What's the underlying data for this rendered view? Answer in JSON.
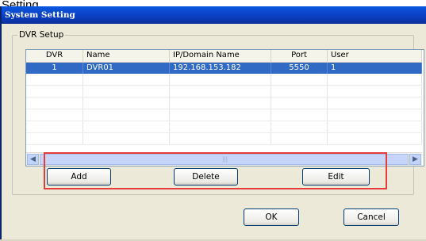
{
  "document_caption": "Setting.",
  "window": {
    "title": "System Setting"
  },
  "group": {
    "label": "DVR Setup"
  },
  "table": {
    "columns": [
      "DVR",
      "Name",
      "IP/Domain Name",
      "Port",
      "User"
    ],
    "rows": [
      {
        "dvr": "1",
        "name": "DVR01",
        "ip": "192.168.153.182",
        "port": "5550",
        "user": "1",
        "selected": true
      }
    ],
    "empty_rows": 6
  },
  "buttons": {
    "add": "Add",
    "delete": "Delete",
    "edit": "Edit",
    "ok": "OK",
    "cancel": "Cancel"
  },
  "highlight_color": "#e53c3c",
  "selection_color": "#316ac5"
}
